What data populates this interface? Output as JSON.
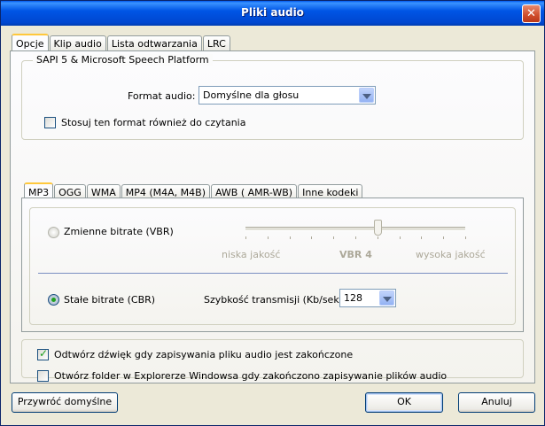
{
  "window": {
    "title": "Pliki audio"
  },
  "main_tabs": [
    {
      "label": "Opcje"
    },
    {
      "label": "Klip audio"
    },
    {
      "label": "Lista odtwarzania"
    },
    {
      "label": "LRC"
    }
  ],
  "sapi": {
    "group_label": "SAPI 5 & Microsoft Speech Platform",
    "format_label": "Format audio:",
    "format_value": "Domyślne dla głosu",
    "apply_checkbox_label": "Stosuj ten format również do czytania",
    "apply_checked": false
  },
  "codec_tabs": [
    {
      "label": "MP3"
    },
    {
      "label": "OGG"
    },
    {
      "label": "WMA"
    },
    {
      "label": "MP4 (M4A, M4B)"
    },
    {
      "label": "AWB ( AMR-WB)"
    },
    {
      "label": "Inne kodeki"
    }
  ],
  "mp3": {
    "vbr_label": "Zmienne bitrate (VBR)",
    "vbr_selected": false,
    "slider_min_label": "niska jakość",
    "slider_max_label": "wysoka jakość",
    "slider_value_label": "VBR 4",
    "slider_level": 0.6,
    "cbr_label": "Stałe bitrate (CBR)",
    "cbr_selected": true,
    "bitrate_label": "Szybkość transmisji (Kb/sek):",
    "bitrate_value": "128"
  },
  "options": {
    "play_sound_label": "Odtwórz dźwięk gdy zapisywania pliku audio jest zakończone",
    "play_sound_checked": true,
    "open_folder_label": "Otwórz folder w Explorerze Windowsa gdy zakończono zapisywanie plików audio",
    "open_folder_checked": false
  },
  "buttons": {
    "restore_defaults": "Przywróć domyślne",
    "ok": "OK",
    "cancel": "Anuluj"
  },
  "colors": {
    "titlebar": "#0055e5",
    "face": "#ece9d8",
    "check_mark": "#21a121"
  }
}
